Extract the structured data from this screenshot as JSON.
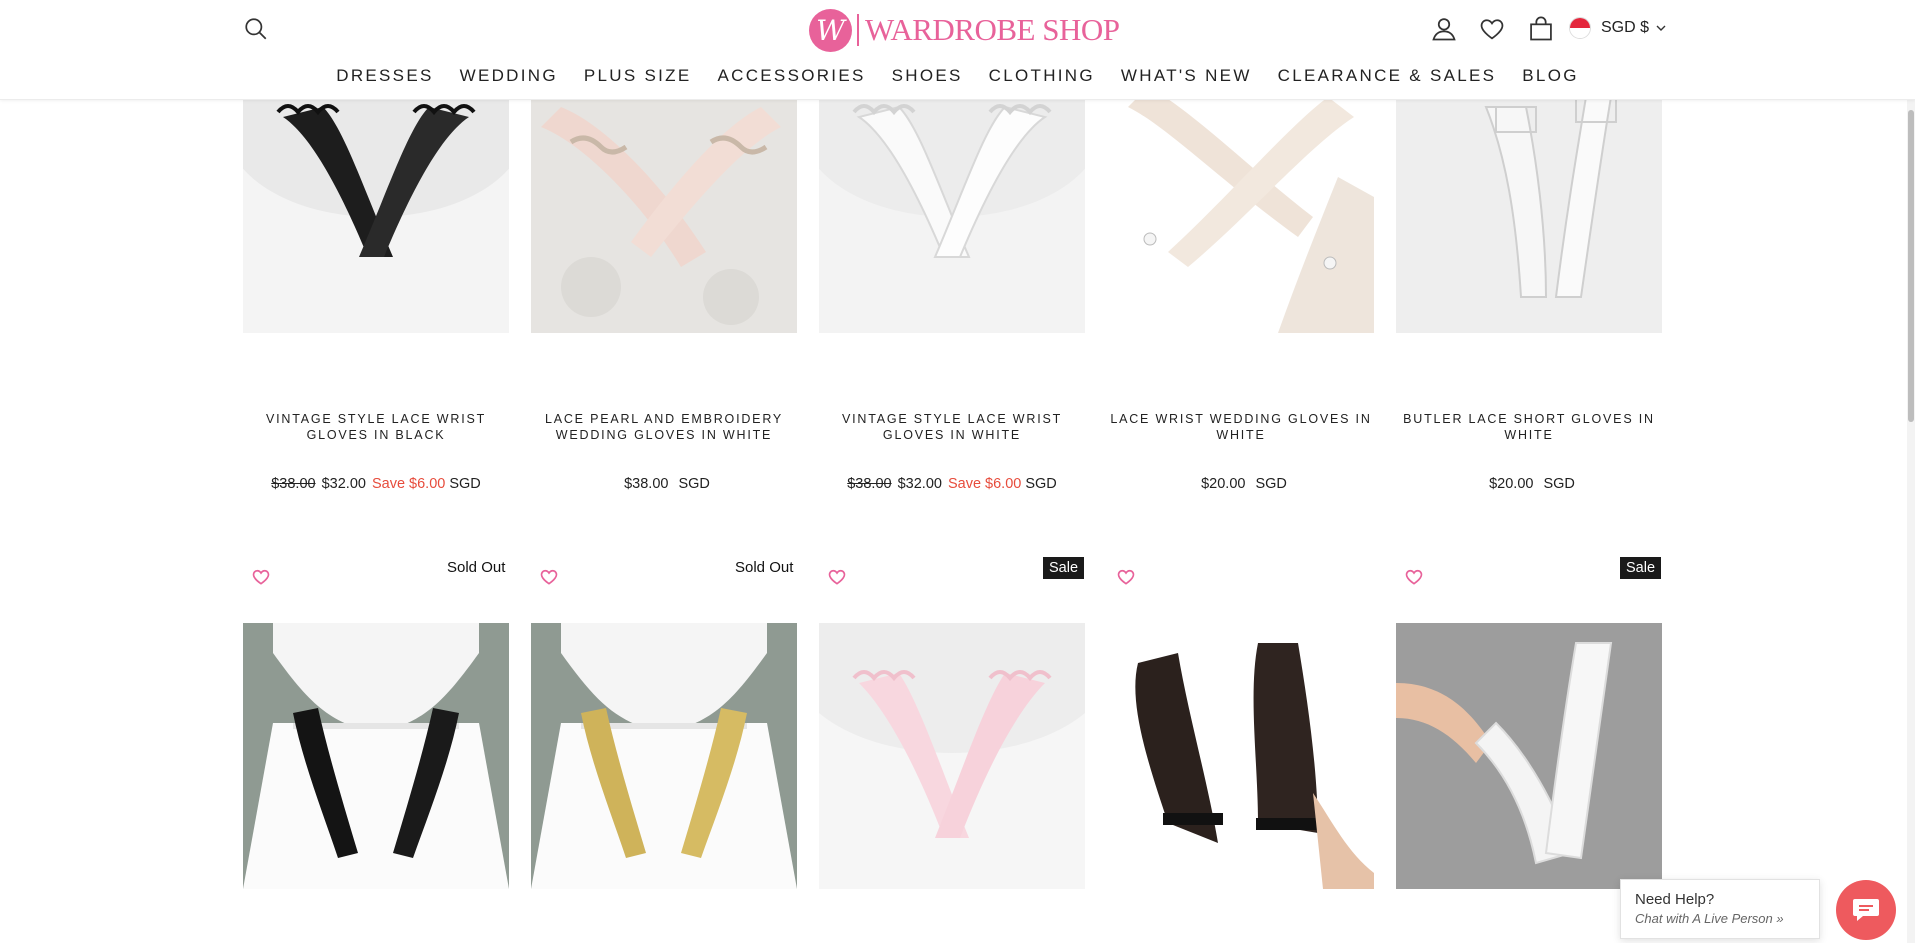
{
  "brand": {
    "logo_letter": "W",
    "name": "WARDROBE SHOP",
    "color": "#e8629a"
  },
  "header": {
    "currency": "SGD $"
  },
  "nav": [
    "DRESSES",
    "WEDDING",
    "PLUS SIZE",
    "ACCESSORIES",
    "SHOES",
    "CLOTHING",
    "WHAT'S NEW",
    "CLEARANCE & SALES",
    "BLOG"
  ],
  "row1": [
    {
      "title": "VINTAGE STYLE LACE WRIST GLOVES IN BLACK",
      "old_price": "$38.00",
      "price": "$32.00",
      "save": "Save $6.00",
      "currency": "SGD"
    },
    {
      "title": "LACE PEARL AND EMBROIDERY WEDDING GLOVES IN WHITE",
      "old_price": "",
      "price": "$38.00",
      "save": "",
      "currency": "SGD"
    },
    {
      "title": "VINTAGE STYLE LACE WRIST GLOVES IN WHITE",
      "old_price": "$38.00",
      "price": "$32.00",
      "save": "Save $6.00",
      "currency": "SGD"
    },
    {
      "title": "LACE WRIST WEDDING GLOVES IN WHITE",
      "old_price": "",
      "price": "$20.00",
      "save": "",
      "currency": "SGD"
    },
    {
      "title": "BUTLER LACE SHORT GLOVES IN WHITE",
      "old_price": "",
      "price": "$20.00",
      "save": "",
      "currency": "SGD"
    }
  ],
  "row2": [
    {
      "badge": "Sold Out",
      "badge_type": "text"
    },
    {
      "badge": "Sold Out",
      "badge_type": "text"
    },
    {
      "badge": "Sale",
      "badge_type": "dark"
    },
    {
      "badge": "",
      "badge_type": "none"
    },
    {
      "badge": "Sale",
      "badge_type": "dark"
    }
  ],
  "help": {
    "title": "Need Help?",
    "subtitle": "Chat with A Live Person »"
  },
  "colors": {
    "accent_pink": "#e8629a",
    "save_red": "#e74c3c",
    "chat_button": "#ee5a5e",
    "badge_dark": "#1a1a1a"
  },
  "icons": [
    "search-icon",
    "account-icon",
    "wishlist-heart-icon",
    "cart-bag-icon",
    "singapore-flag-icon",
    "chevron-down-icon",
    "chat-bubble-icon"
  ]
}
